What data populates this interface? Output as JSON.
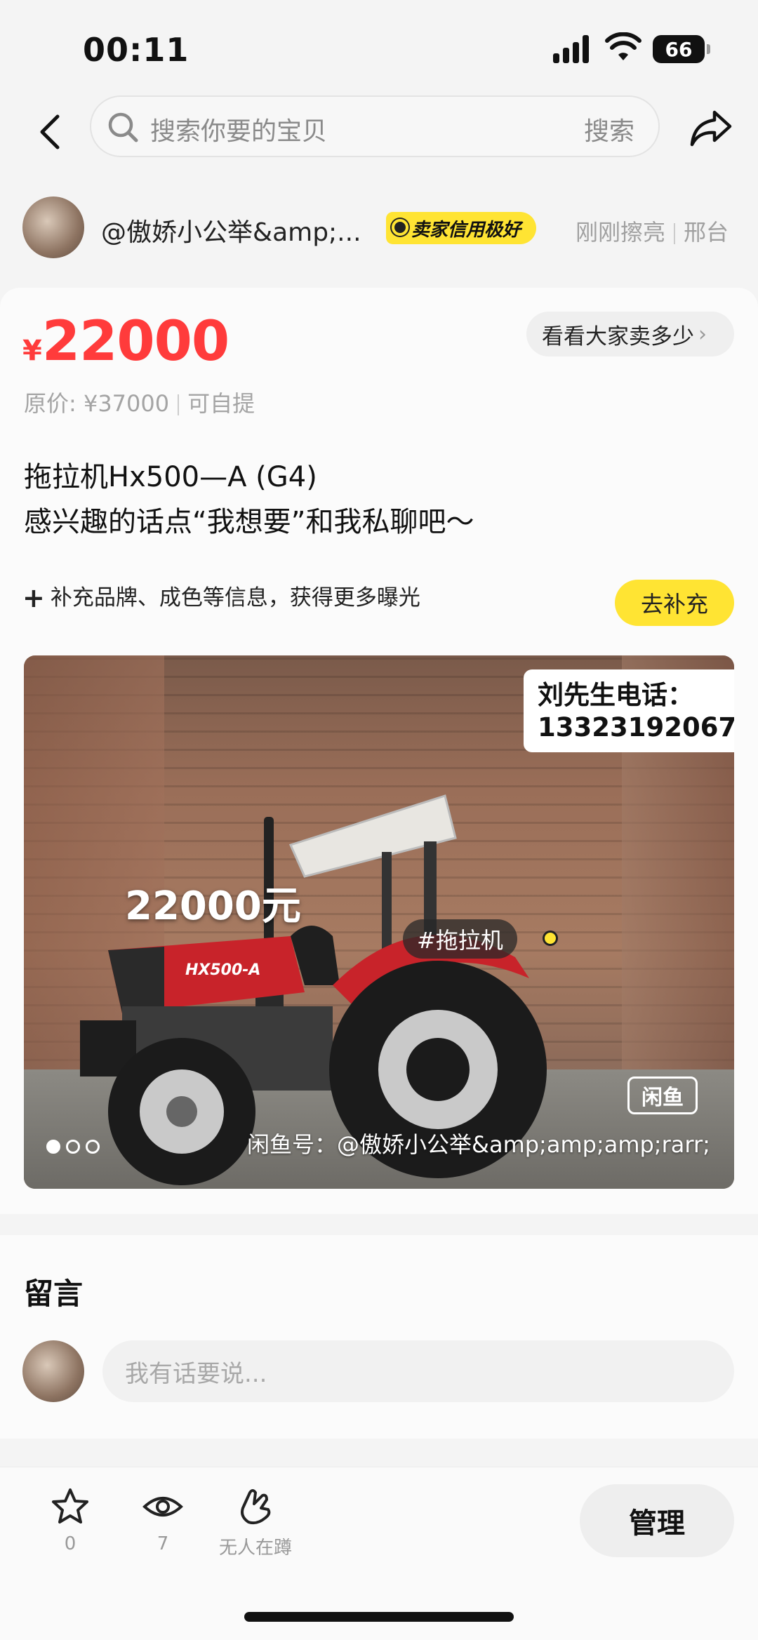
{
  "status_bar": {
    "time": "00:11",
    "battery": "66"
  },
  "search": {
    "placeholder": "搜索你要的宝贝",
    "button": "搜索"
  },
  "seller": {
    "name": "@傲娇小公举&amp;...",
    "badge": "卖家信用极好",
    "refreshed": "刚刚擦亮",
    "location": "邢台"
  },
  "item": {
    "currency": "¥",
    "price": "22000",
    "compare_label": "看看大家卖多少",
    "original_price": "原价: ¥37000",
    "pickup": "可自提",
    "title_line1": "拖拉机Hx500—A (G4)",
    "title_line2": "感兴趣的话点“我想要”和我私聊吧～",
    "hint": "补充品牌、成色等信息，获得更多曝光",
    "hint_button": "去补充"
  },
  "photo": {
    "contact_line1": "刘先生电话：",
    "contact_line2": "13323192067",
    "price_overlay": "22000元",
    "hashtag": "#拖拉机",
    "logo_text": "闲鱼",
    "watermark": "闲鱼号：@傲娇小公举&amp;amp;amp;rarr;",
    "model_plate": "HX500-A",
    "page_count": 3,
    "active_page": 1
  },
  "comments": {
    "title": "留言",
    "placeholder": "我有话要说..."
  },
  "bottom_bar": {
    "favorites": "0",
    "views": "7",
    "want_label": "无人在蹲",
    "manage": "管理"
  },
  "colors": {
    "price_red": "#ff3b3b",
    "accent_yellow": "#ffe433"
  },
  "icons": [
    "back-icon",
    "search-icon",
    "share-icon",
    "star-icon",
    "eye-icon",
    "hand-icon"
  ]
}
